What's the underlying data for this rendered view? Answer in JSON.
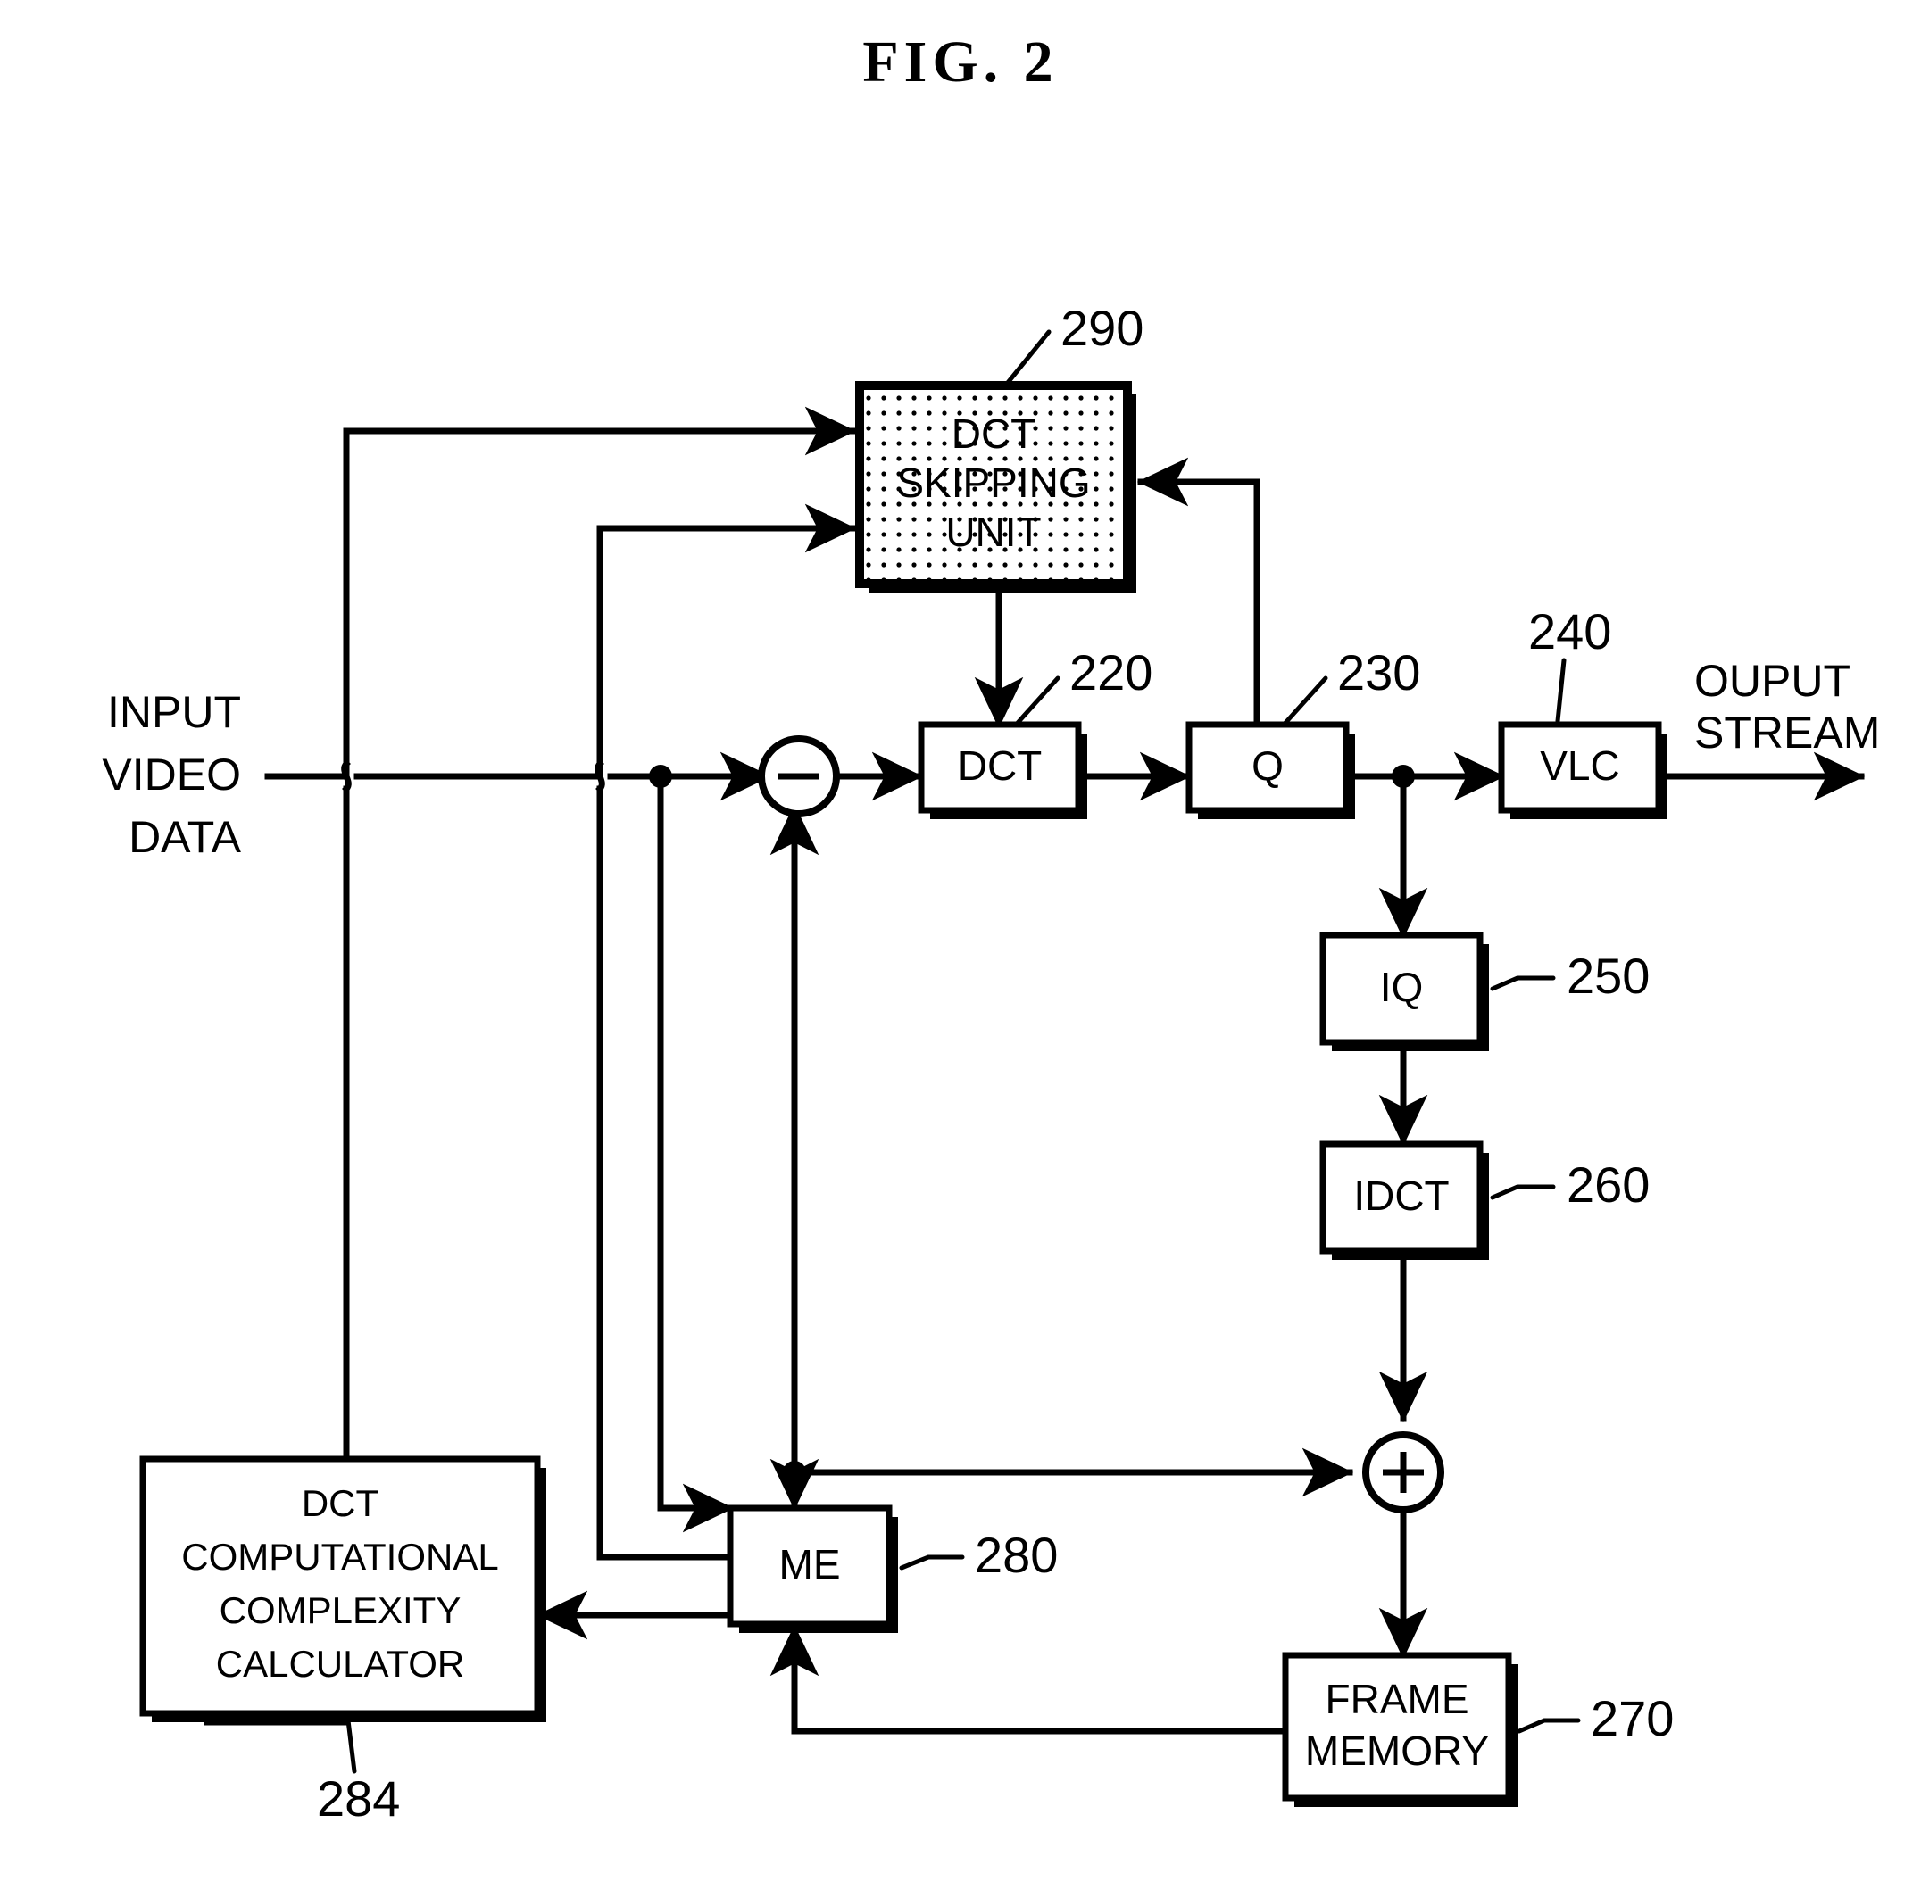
{
  "figure": {
    "title": "FIG.  2",
    "type": "patent-block-diagram"
  },
  "io_labels": {
    "input": {
      "line1": "INPUT",
      "line2": "VIDEO",
      "line3": "DATA"
    },
    "output": {
      "line1": "OUPUT",
      "line2": "STREAM"
    }
  },
  "blocks": {
    "dct_skipping_unit": {
      "line1": "DCT",
      "line2": "SKIPPING",
      "line3": "UNIT",
      "ref": "290"
    },
    "dct": {
      "label": "DCT",
      "ref": "220"
    },
    "q": {
      "label": "Q",
      "ref": "230"
    },
    "vlc": {
      "label": "VLC",
      "ref": "240"
    },
    "iq": {
      "label": "IQ",
      "ref": "250"
    },
    "idct": {
      "label": "IDCT",
      "ref": "260"
    },
    "frame_memory": {
      "line1": "FRAME",
      "line2": "MEMORY",
      "ref": "270"
    },
    "me": {
      "label": "ME",
      "ref": "280"
    },
    "calculator": {
      "line1": "DCT",
      "line2": "COMPUTATIONAL",
      "line3": "COMPLEXITY",
      "line4": "CALCULATOR",
      "ref": "284"
    }
  },
  "operators": {
    "subtractor": {
      "glyph": "minus"
    },
    "adder": {
      "glyph": "plus"
    }
  },
  "colors": {
    "ink": "#000000",
    "paper": "#ffffff"
  }
}
